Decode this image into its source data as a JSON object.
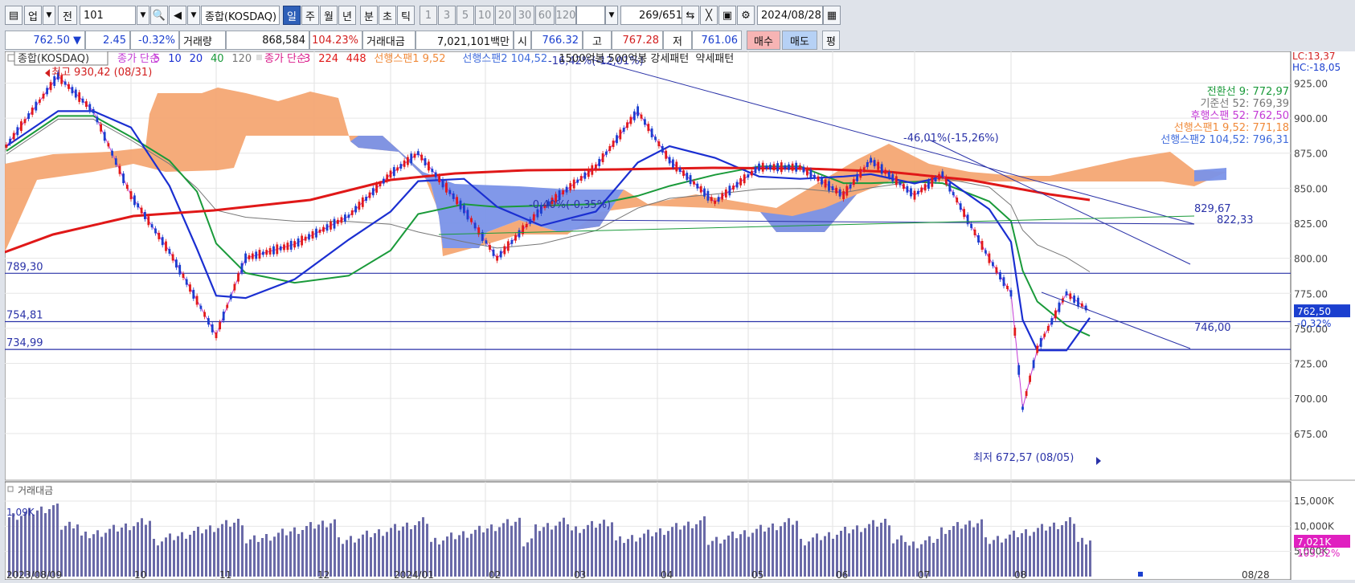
{
  "toolbar": {
    "market_label": "업",
    "prev_label": "전",
    "code_value": "101",
    "index_name": "종합(KOSDAQ)",
    "periods": [
      "일",
      "주",
      "월",
      "년",
      "분",
      "초",
      "틱"
    ],
    "active_period": "일",
    "minutes": [
      "1",
      "3",
      "5",
      "10",
      "20",
      "30",
      "60",
      "120"
    ],
    "count_value": "269",
    "count_total": "/651",
    "date_value": "2024/08/28"
  },
  "quote": {
    "price": "762.50 ▼",
    "change": "2.45",
    "change_pct": "-0.32%",
    "volume_label": "거래량",
    "volume": "868,584",
    "volume_ratio": "104.23%",
    "amount_label": "거래대금",
    "amount": "7,021,101백만",
    "open_label": "시",
    "open": "766.32",
    "high_label": "고",
    "high": "767.28",
    "low_label": "저",
    "low": "761.06",
    "buy_label": "매수",
    "sell_label": "매도",
    "flat_label": "평"
  },
  "legend": {
    "index_name": "종합(KOSDAQ)",
    "ma_label": "종가 단순",
    "ma_periods": [
      "5",
      "10",
      "20",
      "40",
      "120"
    ],
    "ma2_label": "종가 단순",
    "ma2_periods": [
      "3",
      "224",
      "448"
    ],
    "span1": "선행스팬1 9,52",
    "span2": "선행스팬2 104,52",
    "extra": "1500억봉 500억봉 강세패턴",
    "weak": "약세패턴"
  },
  "right_info": {
    "lc": "LC:13,37",
    "hc": "HC:-18,05",
    "ichimoku": [
      {
        "label": "전환선 9: 772,97",
        "color": "#1a9a3a"
      },
      {
        "label": "기준선 52: 769,39",
        "color": "#777777"
      },
      {
        "label": "후행스팬 52: 762,50",
        "color": "#c43ad6"
      },
      {
        "label": "선행스팬1 9,52: 771,18",
        "color": "#f08a3a"
      },
      {
        "label": "선행스팬2 104,52: 796,31",
        "color": "#3f6bdc"
      }
    ],
    "price_tag": "762,50",
    "pct_tag": "-0,32%",
    "vol_tag": "7,021K",
    "vol_pct_tag": "103,32%"
  },
  "annotations": {
    "high": "최고 930,42 (08/31)",
    "low": "최저 672,57 (08/05)",
    "trend1": "-16,42%(-12,01%)",
    "trend2": "-46,01%(-15,26%)",
    "trend3": "-0,40%(-0,35%)",
    "level_789": "789,30",
    "level_754": "754,81",
    "level_734": "734,99",
    "line_829": "829,67",
    "line_822": "822,33",
    "line_746": "746,00",
    "vol_min": "1,09K"
  },
  "volume_panel": {
    "title": "거래대금",
    "y_ticks": [
      "15,000K",
      "10,000K",
      "5,000K"
    ]
  },
  "chart_data": {
    "type": "candlestick",
    "y_ticks": [
      925,
      900,
      875,
      850,
      825,
      800,
      775,
      750,
      725,
      700,
      675
    ],
    "ylim": [
      660,
      935
    ],
    "x_ticks": [
      "2023/08/09",
      "10",
      "11",
      "12",
      "2024/01",
      "02",
      "03",
      "04",
      "05",
      "06",
      "07",
      "08",
      "08/28"
    ],
    "horizontal_levels": [
      789.3,
      754.81,
      734.99
    ],
    "last_close": 762.5,
    "high": 930.42,
    "low": 672.57,
    "price_path": [
      {
        "date": "2023/08/09",
        "close": 880
      },
      {
        "date": "2023/08/31",
        "close": 930
      },
      {
        "date": "2023/09/15",
        "close": 905
      },
      {
        "date": "2023/10/01",
        "close": 845
      },
      {
        "date": "2023/10/15",
        "close": 805
      },
      {
        "date": "2023/10/25",
        "close": 770
      },
      {
        "date": "2023/11/01",
        "close": 745
      },
      {
        "date": "2023/11/10",
        "close": 800
      },
      {
        "date": "2023/11/25",
        "close": 810
      },
      {
        "date": "2023/12/15",
        "close": 830
      },
      {
        "date": "2024/01/01",
        "close": 860
      },
      {
        "date": "2024/01/10",
        "close": 875
      },
      {
        "date": "2024/01/25",
        "close": 835
      },
      {
        "date": "2024/02/05",
        "close": 800
      },
      {
        "date": "2024/02/20",
        "close": 835
      },
      {
        "date": "2024/03/10",
        "close": 865
      },
      {
        "date": "2024/03/25",
        "close": 905
      },
      {
        "date": "2024/04/05",
        "close": 870
      },
      {
        "date": "2024/04/20",
        "close": 840
      },
      {
        "date": "2024/05/05",
        "close": 865
      },
      {
        "date": "2024/05/20",
        "close": 865
      },
      {
        "date": "2024/06/05",
        "close": 845
      },
      {
        "date": "2024/06/15",
        "close": 870
      },
      {
        "date": "2024/07/01",
        "close": 845
      },
      {
        "date": "2024/07/10",
        "close": 860
      },
      {
        "date": "2024/07/25",
        "close": 800
      },
      {
        "date": "2024/08/01",
        "close": 775
      },
      {
        "date": "2024/08/05",
        "close": 693
      },
      {
        "date": "2024/08/10",
        "close": 735
      },
      {
        "date": "2024/08/20",
        "close": 775
      },
      {
        "date": "2024/08/28",
        "close": 762.5
      }
    ],
    "volume_ylim": [
      0,
      15000
    ]
  }
}
